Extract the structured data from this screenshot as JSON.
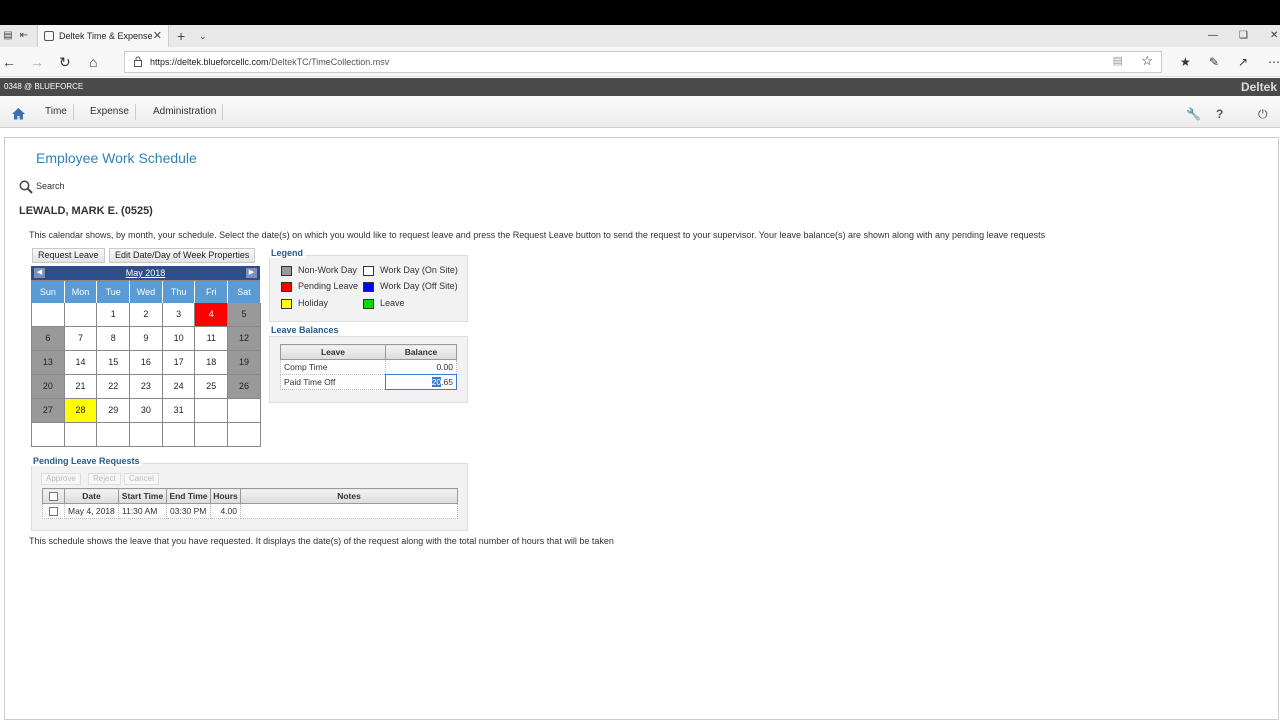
{
  "browser": {
    "tab_title": "Deltek Time & Expense",
    "url_host": "https://deltek.blueforcellc.com",
    "url_path": "/DeltekTC/TimeCollection.msv"
  },
  "app": {
    "user_label": "0348 @ BLUEFORCE",
    "brand": "Deltek"
  },
  "menu": {
    "items": [
      "Time",
      "Expense",
      "Administration"
    ]
  },
  "page": {
    "title": "Employee Work Schedule",
    "search_label": "Search",
    "employee": "LEWALD, MARK E. (0525)",
    "description": "This calendar shows, by month, your schedule. Select the date(s) on which you would like to request leave and press the Request Leave button to send the request to your supervisor. Your leave balance(s) are shown along with any pending leave requests",
    "footer_text": "This schedule shows the leave that you have requested. It displays the date(s) of the request along with the total number of hours that will be taken"
  },
  "buttons": {
    "request_leave": "Request Leave",
    "edit_properties": "Edit Date/Day of Week Properties"
  },
  "calendar": {
    "month": "May 2018",
    "days_of_week": [
      "Sun",
      "Mon",
      "Tue",
      "Wed",
      "Thu",
      "Fri",
      "Sat"
    ],
    "weeks": [
      [
        {
          "d": ""
        },
        {
          "d": ""
        },
        {
          "d": "1"
        },
        {
          "d": "2"
        },
        {
          "d": "3"
        },
        {
          "d": "4",
          "t": "pending"
        },
        {
          "d": "5",
          "t": "nonwork"
        }
      ],
      [
        {
          "d": "6",
          "t": "nonwork"
        },
        {
          "d": "7"
        },
        {
          "d": "8"
        },
        {
          "d": "9"
        },
        {
          "d": "10"
        },
        {
          "d": "11"
        },
        {
          "d": "12",
          "t": "nonwork"
        }
      ],
      [
        {
          "d": "13",
          "t": "nonwork"
        },
        {
          "d": "14"
        },
        {
          "d": "15"
        },
        {
          "d": "16"
        },
        {
          "d": "17"
        },
        {
          "d": "18"
        },
        {
          "d": "19",
          "t": "nonwork"
        }
      ],
      [
        {
          "d": "20",
          "t": "nonwork"
        },
        {
          "d": "21"
        },
        {
          "d": "22"
        },
        {
          "d": "23"
        },
        {
          "d": "24"
        },
        {
          "d": "25"
        },
        {
          "d": "26",
          "t": "nonwork"
        }
      ],
      [
        {
          "d": "27",
          "t": "nonwork"
        },
        {
          "d": "28",
          "t": "holiday"
        },
        {
          "d": "29"
        },
        {
          "d": "30"
        },
        {
          "d": "31"
        },
        {
          "d": ""
        },
        {
          "d": ""
        }
      ],
      [
        {
          "d": ""
        },
        {
          "d": ""
        },
        {
          "d": ""
        },
        {
          "d": ""
        },
        {
          "d": ""
        },
        {
          "d": ""
        },
        {
          "d": ""
        }
      ]
    ]
  },
  "legend": {
    "title": "Legend",
    "items": [
      {
        "label": "Non-Work Day",
        "color": "#999999"
      },
      {
        "label": "Work Day (On Site)",
        "color": "#ffffff"
      },
      {
        "label": "Pending Leave",
        "color": "#ff0000"
      },
      {
        "label": "Work Day (Off Site)",
        "color": "#0000ff"
      },
      {
        "label": "Holiday",
        "color": "#ffff00"
      },
      {
        "label": "Leave",
        "color": "#00dd00"
      }
    ]
  },
  "leave_balances": {
    "title": "Leave Balances",
    "headers": [
      "Leave",
      "Balance"
    ],
    "rows": [
      {
        "leave": "Comp Time",
        "balance": "0.00"
      },
      {
        "leave": "Paid Time Off",
        "balance_selected": "20",
        "balance_rest": ".65"
      }
    ]
  },
  "pending_requests": {
    "title": "Pending Leave Requests",
    "actions": [
      "Approve",
      "Reject",
      "Cancel"
    ],
    "headers": [
      "Date",
      "Start Time",
      "End Time",
      "Hours",
      "Notes"
    ],
    "rows": [
      {
        "date": "May 4, 2018",
        "start": "11:30 AM",
        "end": "03:30 PM",
        "hours": "4.00",
        "notes": ""
      }
    ]
  }
}
